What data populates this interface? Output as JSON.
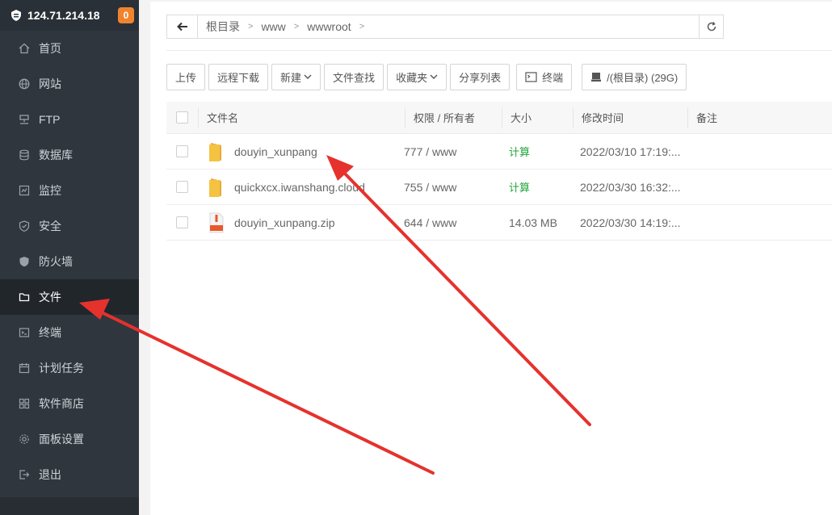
{
  "sidebar": {
    "ip": "124.71.214.18",
    "badge": "0",
    "items": [
      {
        "label": "首页",
        "icon": "home-icon"
      },
      {
        "label": "网站",
        "icon": "globe-icon"
      },
      {
        "label": "FTP",
        "icon": "ftp-icon"
      },
      {
        "label": "数据库",
        "icon": "database-icon"
      },
      {
        "label": "监控",
        "icon": "monitor-icon"
      },
      {
        "label": "安全",
        "icon": "shield-icon"
      },
      {
        "label": "防火墙",
        "icon": "firewall-icon"
      },
      {
        "label": "文件",
        "icon": "folder-icon"
      },
      {
        "label": "终端",
        "icon": "terminal-icon"
      },
      {
        "label": "计划任务",
        "icon": "calendar-icon"
      },
      {
        "label": "软件商店",
        "icon": "grid-icon"
      },
      {
        "label": "面板设置",
        "icon": "gear-icon"
      },
      {
        "label": "退出",
        "icon": "logout-icon"
      }
    ],
    "active_index": 7
  },
  "breadcrumb": {
    "segments": [
      "根目录",
      "www",
      "wwwroot"
    ]
  },
  "toolbar": {
    "upload": "上传",
    "remote_download": "远程下载",
    "new": "新建",
    "file_search": "文件查找",
    "favorites": "收藏夹",
    "share_list": "分享列表",
    "terminal": "终端",
    "disk": "/(根目录) (29G)"
  },
  "table": {
    "headers": {
      "name": "文件名",
      "perm": "权限 / 所有者",
      "size": "大小",
      "mtime": "修改时间",
      "note": "备注"
    },
    "rows": [
      {
        "type": "folder",
        "name": "douyin_xunpang",
        "perm": "777 / www",
        "size": "计算",
        "mtime": "2022/03/10 17:19:..."
      },
      {
        "type": "folder",
        "name": "quickxcx.iwanshang.cloud",
        "perm": "755 / www",
        "size": "计算",
        "mtime": "2022/03/30 16:32:..."
      },
      {
        "type": "zip",
        "name": "douyin_xunpang.zip",
        "perm": "644 / www",
        "size": "14.03 MB",
        "mtime": "2022/03/30 14:19:..."
      }
    ]
  },
  "colors": {
    "sidebar_bg": "#30363d",
    "accent_green": "#20a53a",
    "badge_orange": "#f0842e",
    "arrow_red": "#e5322d",
    "folder_yellow": "#f5c342"
  }
}
